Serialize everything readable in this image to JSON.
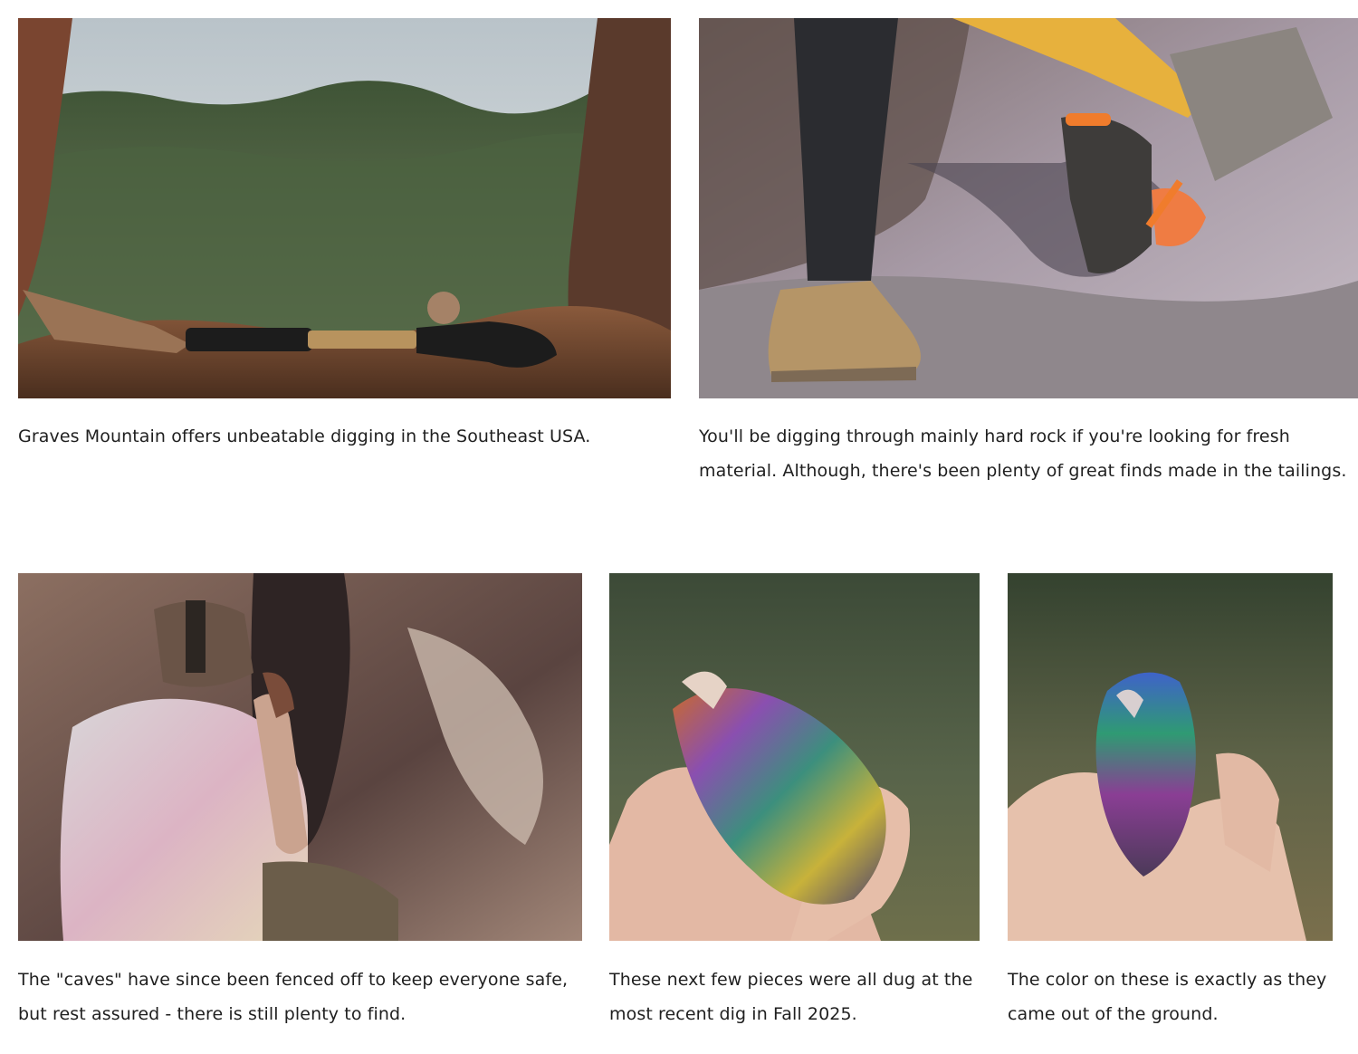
{
  "gallery": {
    "items": [
      {
        "caption": "Graves Mountain offers unbeatable digging in the Southeast USA."
      },
      {
        "caption": "You'll be digging through mainly hard rock if you're looking for fresh material. Although, there's been plenty of great finds made in the tailings."
      },
      {
        "caption": "The \"caves\" have since been fenced off to keep everyone safe, but rest assured - there is still plenty to find."
      },
      {
        "caption": "These next few pieces were all dug at the most recent dig in Fall 2025."
      },
      {
        "caption": "The color on these is exactly as they came out of the ground."
      }
    ]
  }
}
